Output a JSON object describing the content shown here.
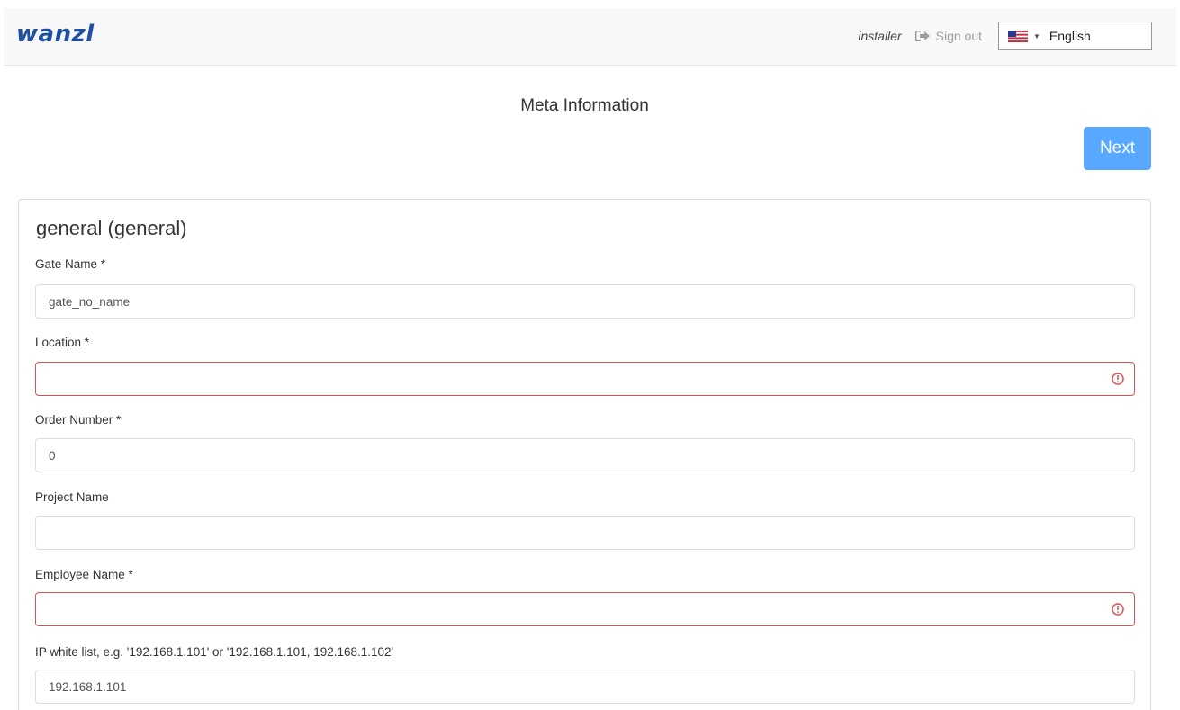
{
  "header": {
    "logo": "wanzl",
    "user": "installer",
    "sign_out": "Sign out",
    "language": "English"
  },
  "page": {
    "title": "Meta Information",
    "next_label": "Next"
  },
  "form": {
    "section_title": "general (general)",
    "fields": [
      {
        "label": "Gate Name *",
        "value": "gate_no_name",
        "error": false
      },
      {
        "label": "Location *",
        "value": "",
        "error": true
      },
      {
        "label": "Order Number *",
        "value": "0",
        "error": false
      },
      {
        "label": "Project Name",
        "value": "",
        "error": false
      },
      {
        "label": "Employee Name *",
        "value": "",
        "error": true
      },
      {
        "label": "IP white list, e.g. '192.168.1.101' or '192.168.1.101, 192.168.1.102'",
        "value": "192.168.1.101",
        "error": false
      }
    ]
  },
  "colors": {
    "logo": "#1d4fa3",
    "primary_button": "#59a8ff",
    "error_border": "#d9534f"
  },
  "icons": {
    "sign_out": "sign-out-icon",
    "flag": "us-flag-icon",
    "error": "exclamation-circle-icon"
  }
}
